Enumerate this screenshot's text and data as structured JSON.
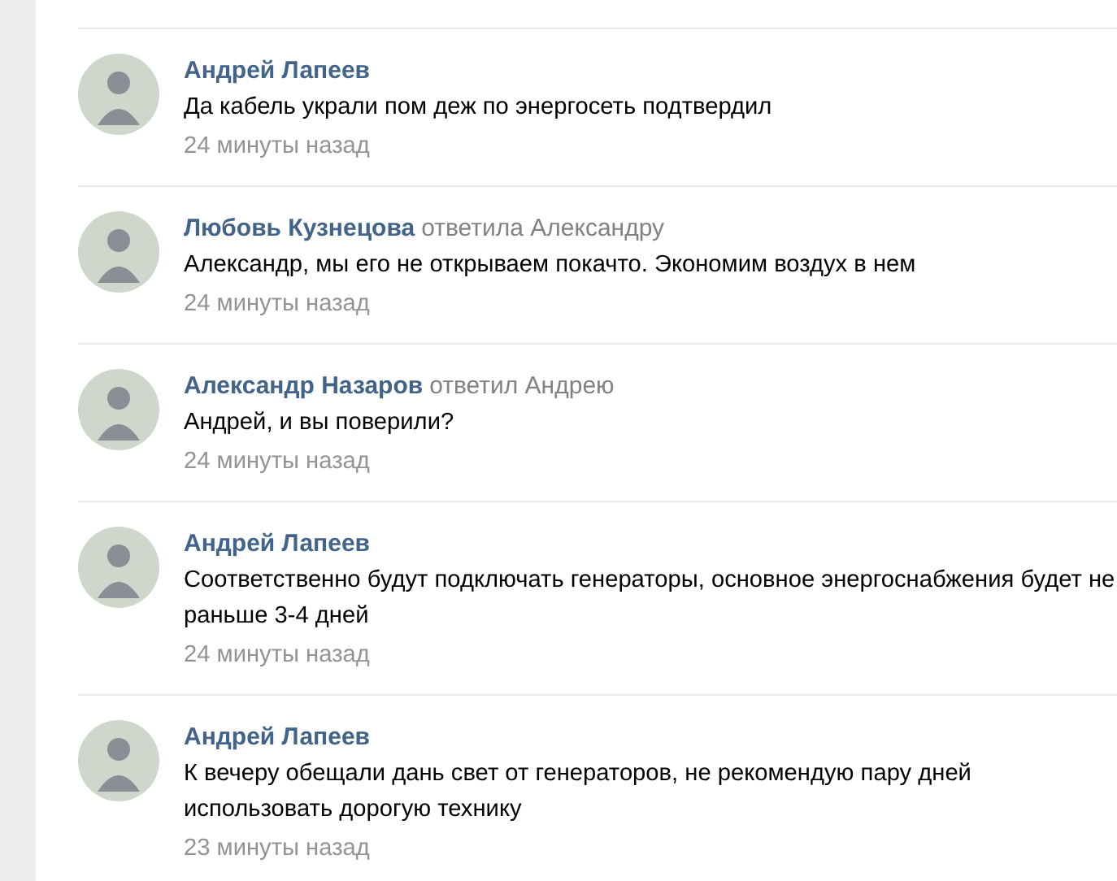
{
  "comments": [
    {
      "author": "Андрей Лапеев",
      "text": "Да кабель украли пом деж по энергосеть подтвердил",
      "time": "24 минуты назад"
    },
    {
      "author": "Любовь Кузнецова",
      "reply": "ответила Александру",
      "text": "Александр, мы его не открываем покачто. Экономим воздух в нем",
      "time": "24 минуты назад"
    },
    {
      "author": "Александр Назаров",
      "reply": "ответил Андрею",
      "text": "Андрей, и вы поверили?",
      "time": "24 минуты назад"
    },
    {
      "author": "Андрей Лапеев",
      "text": "Соответственно будут подключать генераторы, основное энергоснабжения будет не раньше 3-4 дней",
      "time": "24 минуты назад"
    },
    {
      "author": "Андрей Лапеев",
      "text": "К вечеру обещали дань свет от генераторов, не рекомендую пару дней использовать дорогую технику",
      "time": "23 минуты назад"
    }
  ]
}
